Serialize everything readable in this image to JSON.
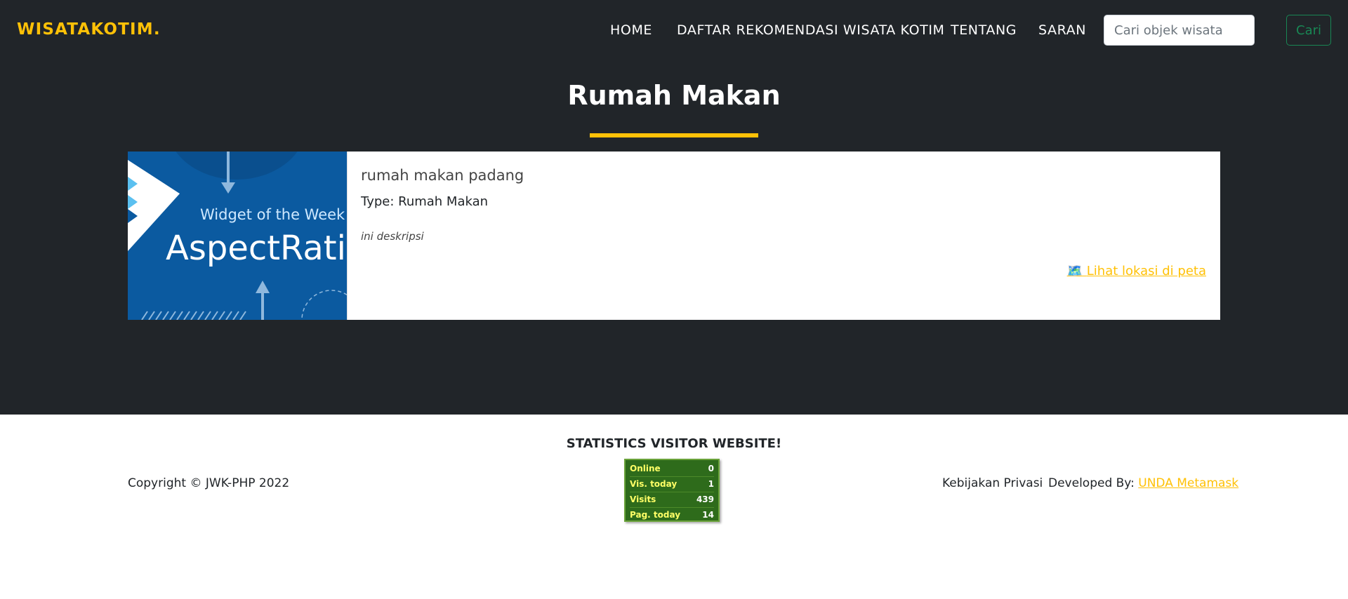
{
  "nav": {
    "brand": "WISATAKOTIM.",
    "links": [
      "HOME",
      "DAFTAR REKOMENDASI WISATA KOTIM",
      "TENTANG",
      "SARAN"
    ],
    "search_placeholder": "Cari objek wisata",
    "search_button": "Cari"
  },
  "page": {
    "title": "Rumah Makan"
  },
  "card": {
    "image_widget": "Widget of the Week",
    "image_title": "AspectRatio",
    "name": "rumah makan padang",
    "type": "Type: Rumah Makan",
    "description": "ini deskripsi",
    "map_icon": "map-icon",
    "map_link": "Lihat lokasi di peta"
  },
  "footer": {
    "stats_title": "STATISTICS VISITOR WEBSITE!",
    "copyright": "Copyright © JWK-PHP 2022",
    "privacy": "Kebijakan Privasi",
    "developed_by": "Developed By:",
    "developer": "UNDA Metamask",
    "stats": [
      {
        "label": "Online",
        "value": "0"
      },
      {
        "label": "Vis. today",
        "value": "1"
      },
      {
        "label": "Visits",
        "value": "439"
      },
      {
        "label": "Pag. today",
        "value": "14"
      }
    ]
  }
}
